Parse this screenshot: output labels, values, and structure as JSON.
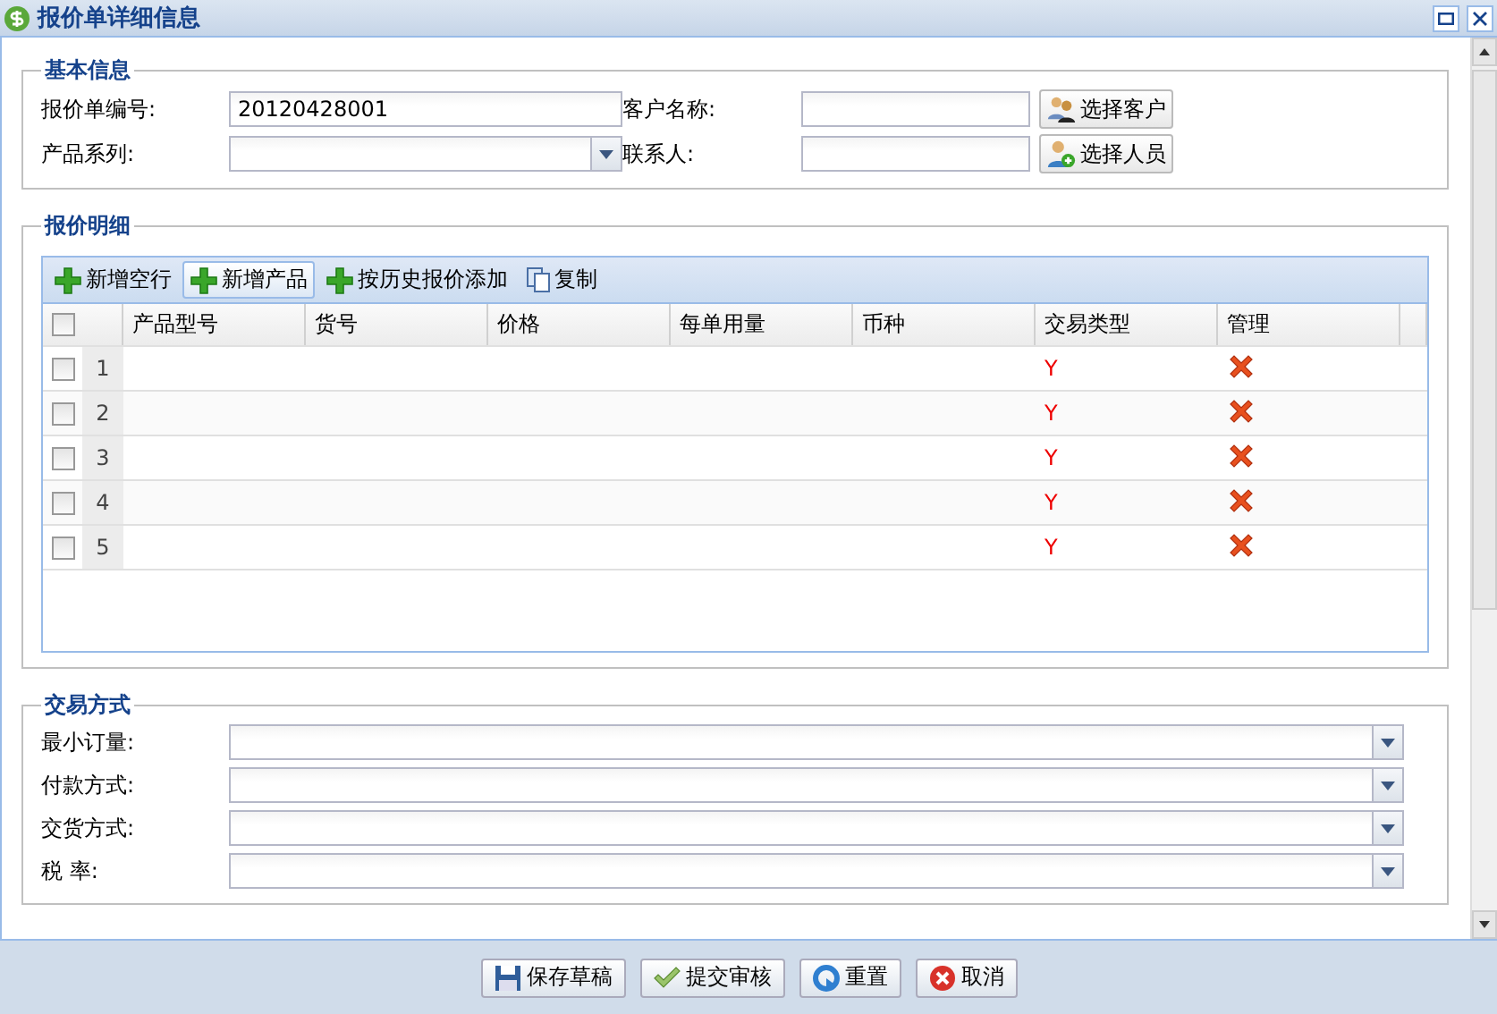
{
  "window": {
    "title": "报价单详细信息"
  },
  "basic_info": {
    "legend": "基本信息",
    "fields": [
      {
        "label": "报价单编号:",
        "kind": "text",
        "value": "20120428001"
      },
      {
        "label": "客户名称:",
        "kind": "text",
        "button": {
          "label": "选择客户",
          "kind": "customer"
        }
      },
      {
        "label": "产品系列:",
        "kind": "select"
      },
      {
        "label": "联系人:",
        "kind": "text",
        "button": {
          "label": "选择人员",
          "kind": "person"
        }
      }
    ]
  },
  "quote_detail": {
    "legend": "报价明细",
    "toolbar": [
      {
        "label": "新增空行",
        "kind": "add",
        "hover": false
      },
      {
        "label": "新增产品",
        "kind": "add",
        "hover": true
      },
      {
        "label": "按历史报价添加",
        "kind": "add",
        "hover": false
      },
      {
        "label": "复制",
        "kind": "copy",
        "hover": false
      }
    ],
    "select_all_checked": false,
    "columns": [
      "产品型号",
      "货号",
      "价格",
      "每单用量",
      "币种",
      "交易类型",
      "管理"
    ],
    "rows": [
      {
        "number": "1",
        "checked": false,
        "trade_type": "Y"
      },
      {
        "number": "2",
        "checked": false,
        "trade_type": "Y"
      },
      {
        "number": "3",
        "checked": false,
        "trade_type": "Y"
      },
      {
        "number": "4",
        "checked": false,
        "trade_type": "Y"
      },
      {
        "number": "5",
        "checked": false,
        "trade_type": "Y"
      }
    ]
  },
  "trade_method": {
    "legend": "交易方式",
    "fields": [
      {
        "label": "最小订量:"
      },
      {
        "label": "付款方式:"
      },
      {
        "label": "交货方式:"
      },
      {
        "label": "税 率:"
      }
    ]
  },
  "buttons": [
    {
      "label": "保存草稿",
      "kind": "save"
    },
    {
      "label": "提交审核",
      "kind": "submit"
    },
    {
      "label": "重置",
      "kind": "reset"
    },
    {
      "label": "取消",
      "kind": "cancel"
    }
  ]
}
